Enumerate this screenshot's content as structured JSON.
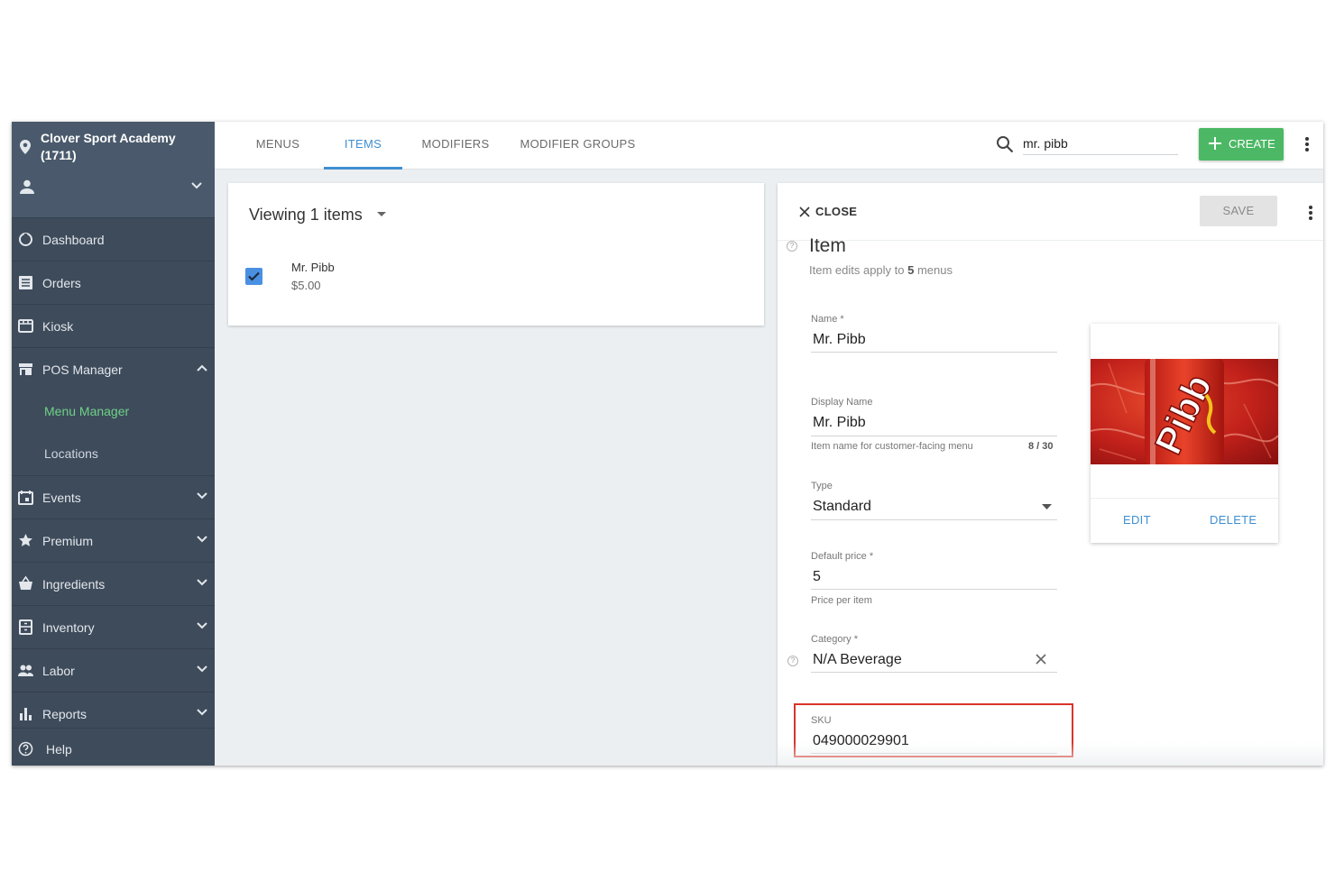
{
  "sidebar": {
    "venue": "Clover Sport Academy (1711)",
    "items": [
      {
        "label": "Dashboard",
        "icon": "dashboard-icon"
      },
      {
        "label": "Orders",
        "icon": "orders-icon"
      },
      {
        "label": "Kiosk",
        "icon": "kiosk-icon"
      },
      {
        "label": "POS Manager",
        "icon": "store-icon"
      },
      {
        "label": "Events",
        "icon": "calendar-icon"
      },
      {
        "label": "Premium",
        "icon": "star-icon"
      },
      {
        "label": "Ingredients",
        "icon": "basket-icon"
      },
      {
        "label": "Inventory",
        "icon": "inventory-icon"
      },
      {
        "label": "Labor",
        "icon": "people-icon"
      },
      {
        "label": "Reports",
        "icon": "bar-chart-icon"
      },
      {
        "label": "Help",
        "icon": "help-icon"
      }
    ],
    "sub_items": [
      {
        "label": "Menu Manager",
        "active": true
      },
      {
        "label": "Locations",
        "active": false
      }
    ]
  },
  "tabs": [
    {
      "label": "MENUS",
      "active": false
    },
    {
      "label": "ITEMS",
      "active": true
    },
    {
      "label": "MODIFIERS",
      "active": false
    },
    {
      "label": "MODIFIER GROUPS",
      "active": false
    }
  ],
  "search": {
    "value": "mr. pibb"
  },
  "create_label": "CREATE",
  "list": {
    "viewing": "Viewing 1 items",
    "items": [
      {
        "name": "Mr. Pibb",
        "price": "$5.00",
        "checked": true
      }
    ]
  },
  "detail": {
    "close_label": "CLOSE",
    "save_label": "SAVE",
    "title": "Item",
    "subtitle_prefix": "Item edits apply to ",
    "subtitle_count": "5",
    "subtitle_suffix": " menus",
    "fields": {
      "name": {
        "label": "Name",
        "value": "Mr. Pibb"
      },
      "display_name": {
        "label": "Display Name",
        "value": "Mr. Pibb",
        "hint": "Item name for customer-facing menu",
        "count": "8 / 30"
      },
      "type": {
        "label": "Type",
        "value": "Standard"
      },
      "default_price": {
        "label": "Default price",
        "value": "5",
        "hint": "Price per item"
      },
      "category": {
        "label": "Category",
        "value": "N/A Beverage"
      },
      "sku": {
        "label": "SKU",
        "value": "049000029901"
      }
    },
    "image": {
      "edit_label": "EDIT",
      "delete_label": "DELETE",
      "brand_text": "Pibb"
    }
  },
  "colors": {
    "accent": "#3f8fd1",
    "create": "#4cb865",
    "sidebar": "#3e4b5b",
    "active_sub": "#6fd187",
    "highlight": "#d9342b"
  }
}
